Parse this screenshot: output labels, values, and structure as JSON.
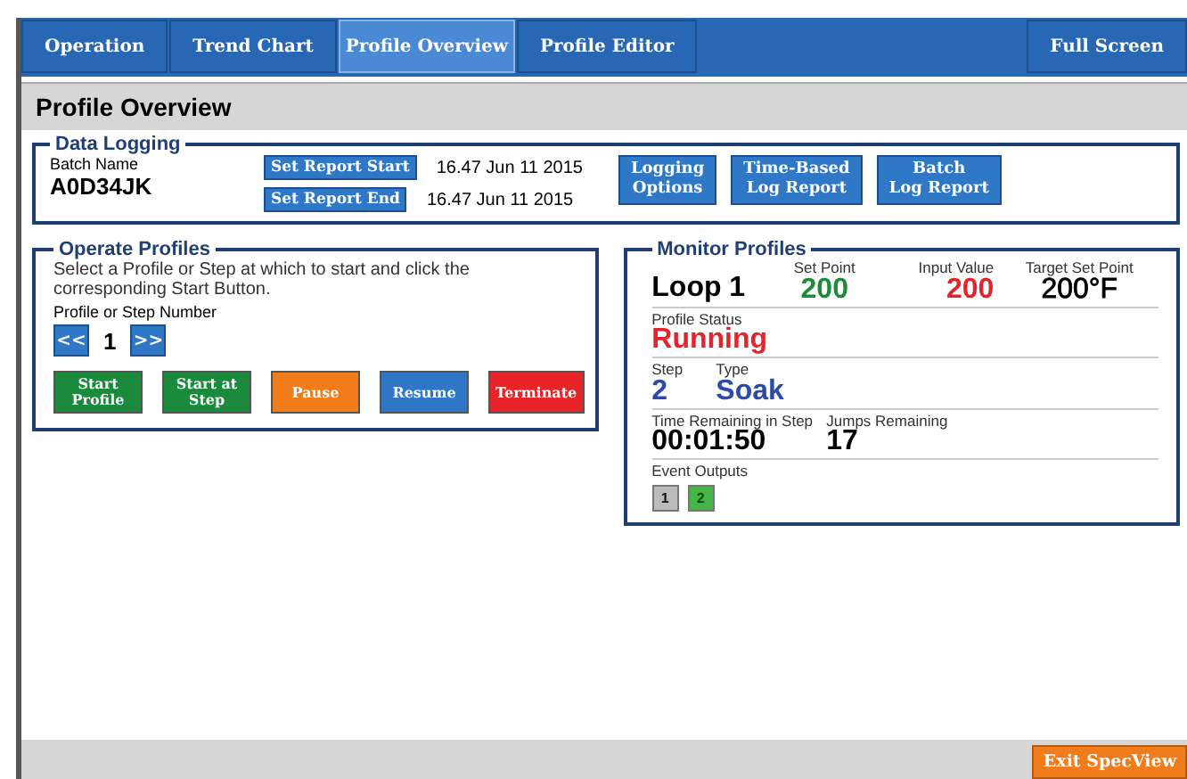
{
  "nav": {
    "tabs": [
      {
        "label": "Operation",
        "selected": false
      },
      {
        "label": "Trend Chart",
        "selected": false
      },
      {
        "label": "Profile Overview",
        "selected": true
      },
      {
        "label": "Profile Editor",
        "selected": false
      }
    ],
    "full_screen": "Full Screen"
  },
  "page_title": "Profile Overview",
  "data_logging": {
    "title": "Data Logging",
    "batch_label": "Batch Name",
    "batch_value": "A0D34JK",
    "report_rows": [
      {
        "button": "Set Report Start",
        "time": "16.47 Jun 11 2015"
      },
      {
        "button": "Set Report End",
        "time": "16.47 Jun 11 2015"
      }
    ],
    "buttons": [
      [
        "Logging",
        "Options"
      ],
      [
        "Time-Based",
        "Log Report"
      ],
      [
        "Batch",
        "Log Report"
      ]
    ]
  },
  "operate": {
    "title": "Operate Profiles",
    "instructions": "Select a Profile or Step at which to start and click the corresponding Start Button.",
    "number_label": "Profile or Step Number",
    "prev": "<<",
    "number": "1",
    "next": ">>",
    "buttons": [
      {
        "lines": [
          "Start",
          "Profile"
        ],
        "color": "#1c8a3c"
      },
      {
        "lines": [
          "Start at",
          "Step"
        ],
        "color": "#1c8a3c"
      },
      {
        "lines": [
          "Pause"
        ],
        "color": "#f07c1c"
      },
      {
        "lines": [
          "Resume"
        ],
        "color": "#2f78c8"
      },
      {
        "lines": [
          "Terminate"
        ],
        "color": "#e82428"
      }
    ]
  },
  "monitor": {
    "title": "Monitor Profiles",
    "loop": "Loop 1",
    "set_point_label": "Set Point",
    "set_point": "200",
    "input_label": "Input Value",
    "input": "200",
    "target_label": "Target Set Point",
    "target": "200°F",
    "status_label": "Profile Status",
    "status": "Running",
    "step_label": "Step",
    "step": "2",
    "type_label": "Type",
    "type": "Soak",
    "time_label": "Time Remaining in Step",
    "time": "00:01:50",
    "jumps_label": "Jumps Remaining",
    "jumps": "17",
    "events_label": "Event Outputs",
    "events": [
      {
        "label": "1",
        "on": false
      },
      {
        "label": "2",
        "on": true
      }
    ]
  },
  "exit_button": "Exit SpecView"
}
